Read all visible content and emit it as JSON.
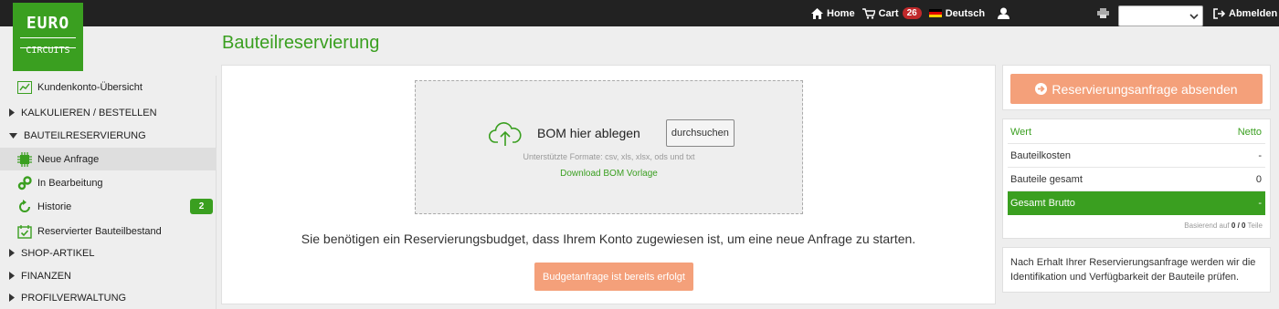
{
  "logo": {
    "line1": "EURO",
    "line2": "CIRCUITS"
  },
  "topnav": {
    "home": "Home",
    "cart": "Cart",
    "cart_count": "26",
    "language": "Deutsch",
    "logout": "Abmelden",
    "select_value": ""
  },
  "page_title": "Bauteilreservierung",
  "sidebar": {
    "overview": "Kundenkonto-Übersicht",
    "calc": "KALKULIEREN / BESTELLEN",
    "reservation": "BAUTEILRESERVIERUNG",
    "new_request": "Neue Anfrage",
    "in_progress": "In Bearbeitung",
    "history": "Historie",
    "history_count": "2",
    "reserved_stock": "Reservierter Bauteilbestand",
    "shop": "SHOP-ARTIKEL",
    "finance": "FINANZEN",
    "profile": "PROFILVERWALTUNG"
  },
  "dropzone": {
    "title": "BOM hier ablegen",
    "browse": "durchsuchen",
    "formats": "Unterstützte Formate: csv, xls, xlsx, ods und txt",
    "template_link": "Download BOM Vorlage"
  },
  "budget": {
    "message": "Sie benötigen ein Reservierungsbudget, dass Ihrem Konto zugewiesen ist, um eine neue Anfrage zu starten.",
    "button": "Budgetanfrage ist bereits erfolgt"
  },
  "submit_button": "Reservierungsanfrage absenden",
  "summary": {
    "head_left": "Wert",
    "head_right": "Netto",
    "rows": [
      {
        "label": "Bauteilkosten",
        "value": "-"
      },
      {
        "label": "Bauteile gesamt",
        "value": "0"
      }
    ],
    "total_label": "Gesamt Brutto",
    "total_value": "-",
    "foot_prefix": "Basierend auf",
    "foot_count": "0 / 0",
    "foot_suffix": "Teile"
  },
  "info_text": "Nach Erhalt Ihrer Reservierungsanfrage werden wir die Identifikation und Verfügbarkeit der Bauteile prüfen.",
  "colors": {
    "brand_green": "#3a9f20",
    "accent_orange": "#f4a07a",
    "badge_red": "#c0292b",
    "topbar": "#222222"
  }
}
